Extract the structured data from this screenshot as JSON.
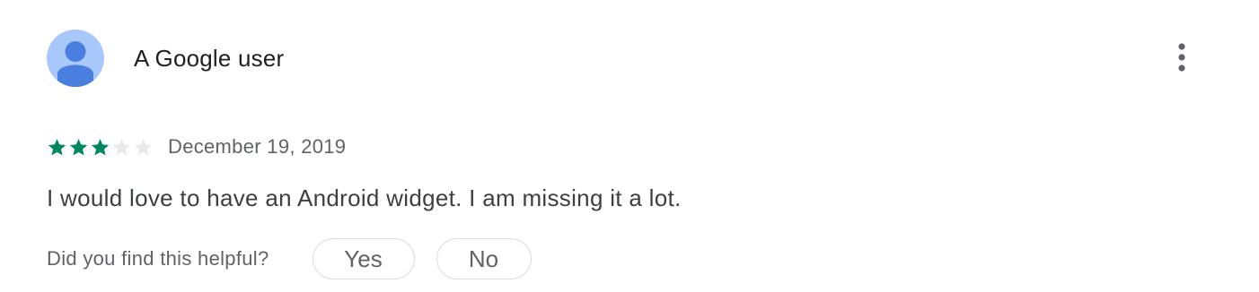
{
  "review": {
    "author_name": "A Google user",
    "avatar_icon": "default-user-avatar",
    "menu_icon": "more-vert-icon",
    "rating": 3,
    "max_rating": 5,
    "date": "December 19, 2019",
    "text": "I would love to have an Android widget. I am missing it a lot."
  },
  "helpful": {
    "question": "Did you find this helpful?",
    "yes_label": "Yes",
    "no_label": "No"
  },
  "colors": {
    "star_filled": "#01875f",
    "star_empty": "#e8eaed",
    "avatar_bg": "#a8c7fa",
    "avatar_figure": "#4a7fe0",
    "text_primary": "#202124",
    "text_secondary": "#5f6368",
    "border": "#dadce0"
  }
}
